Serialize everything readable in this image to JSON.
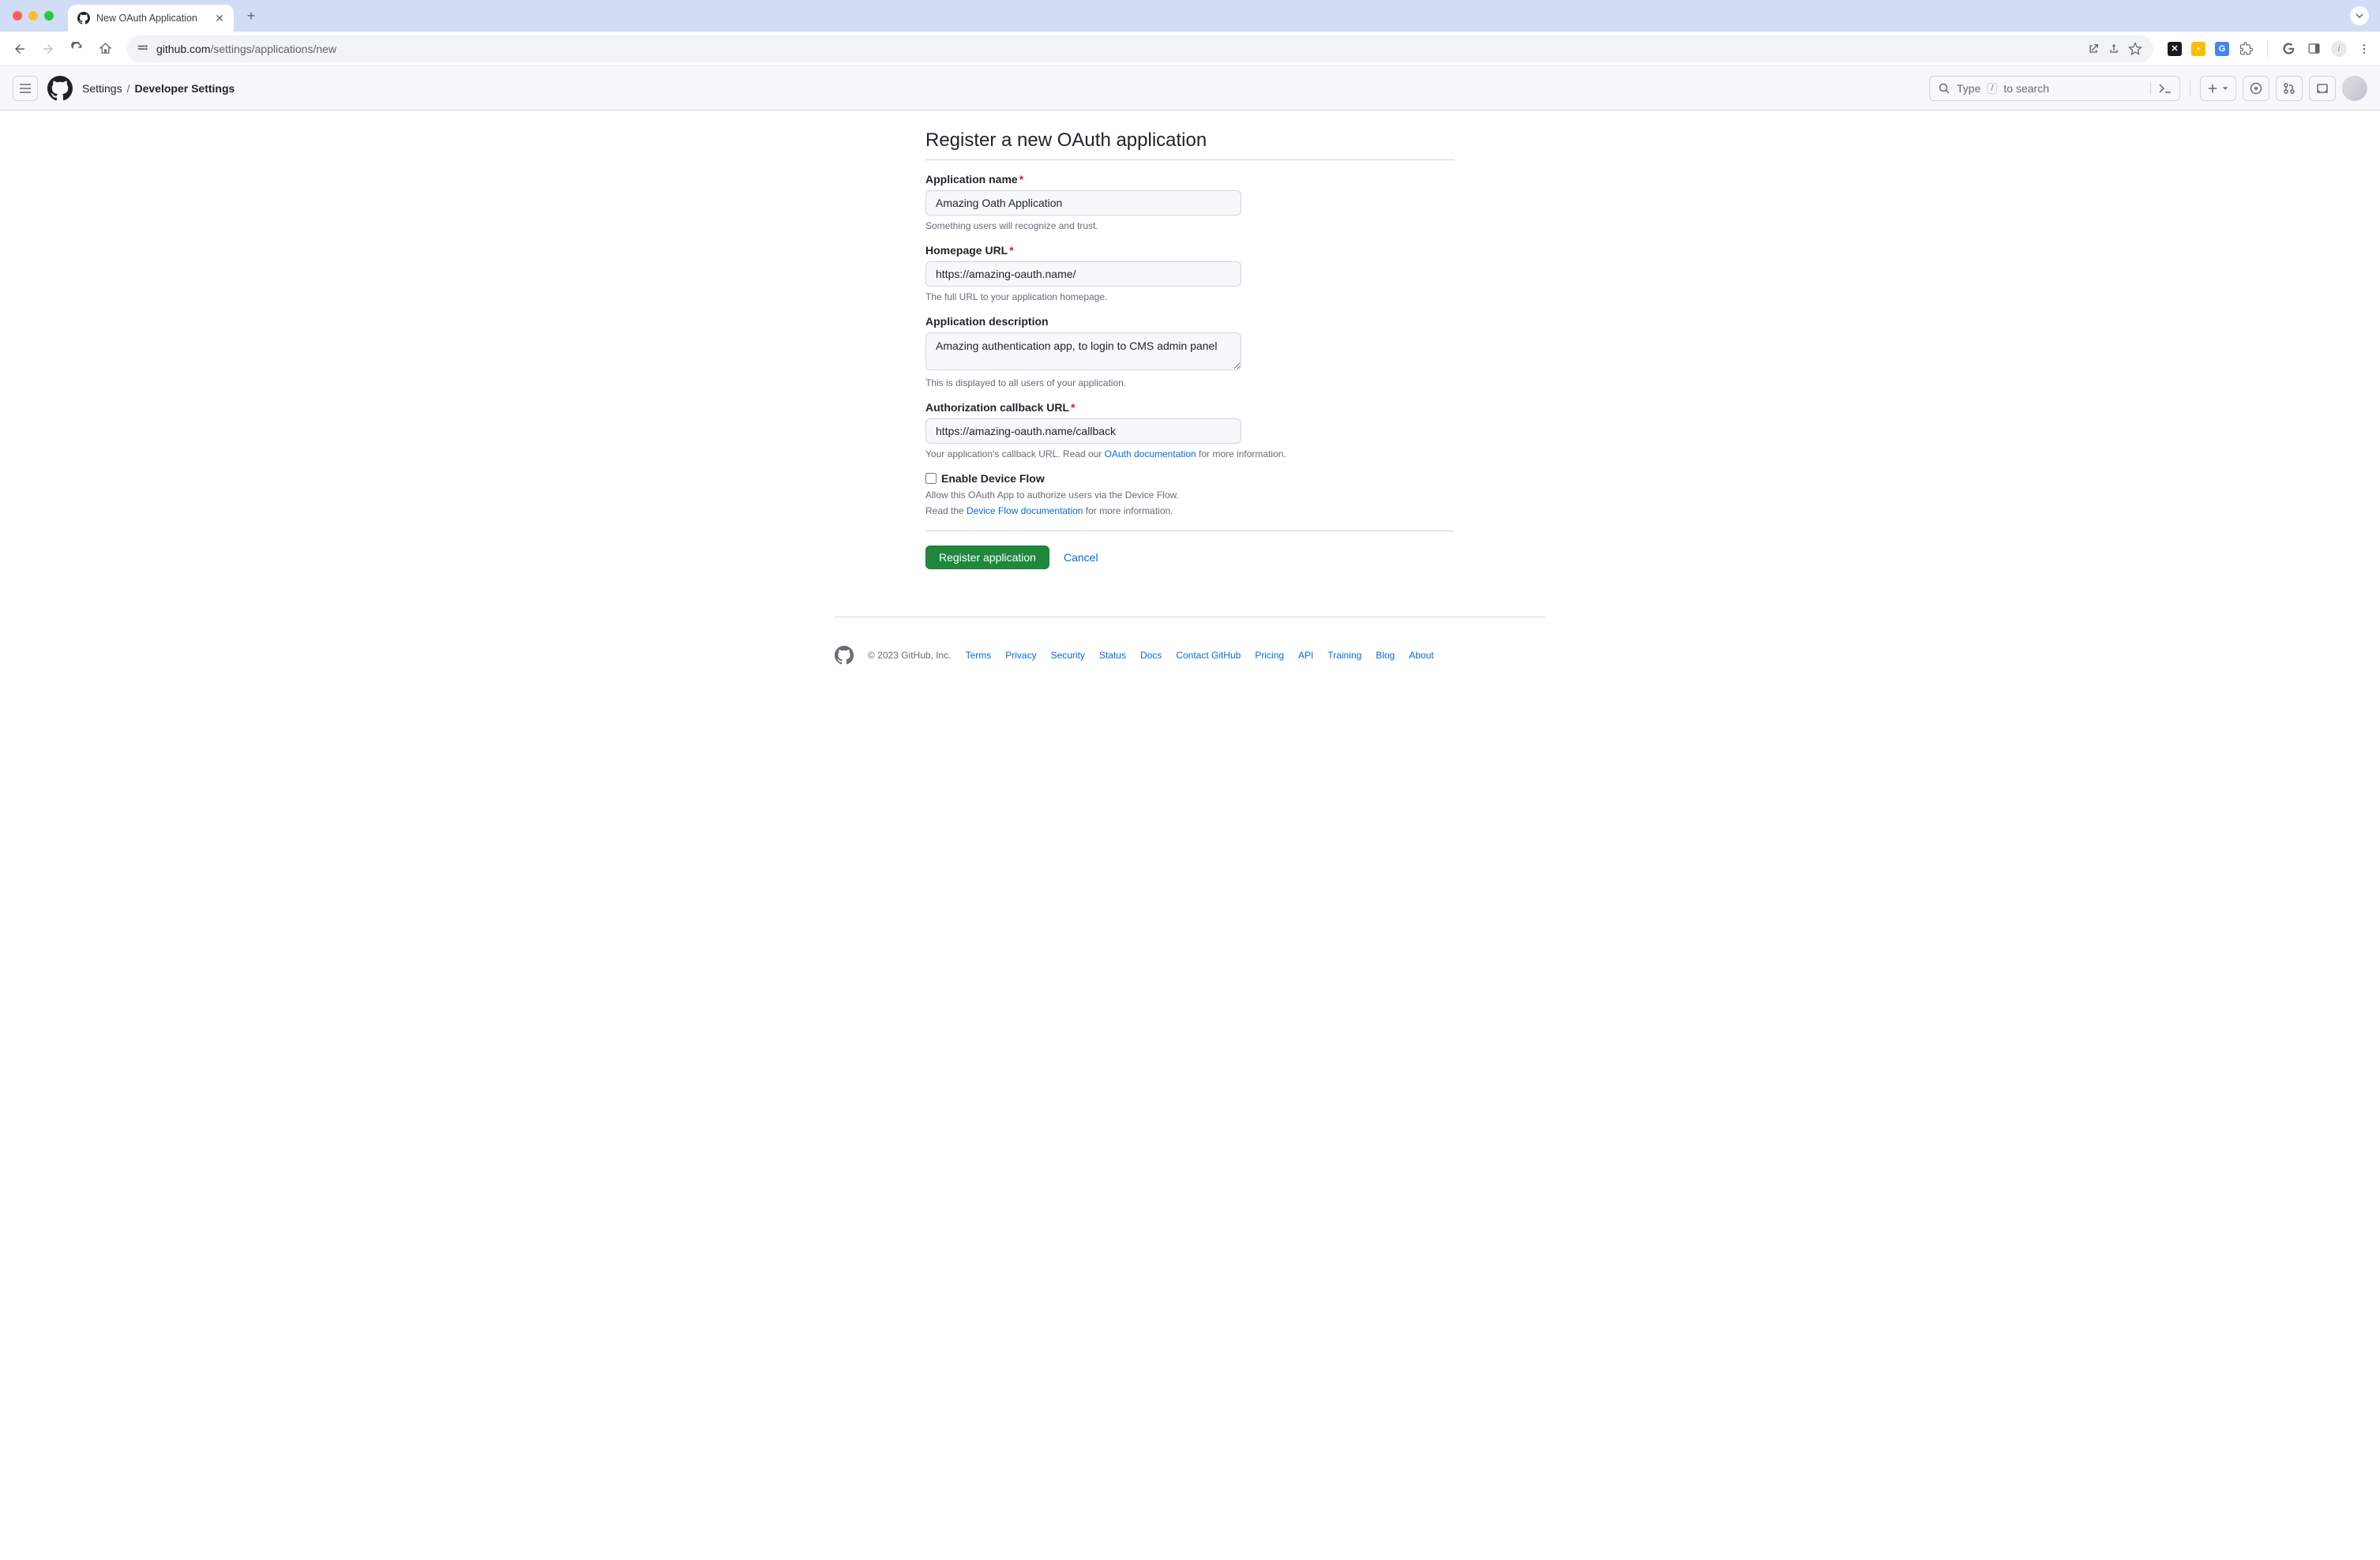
{
  "browser": {
    "tab_title": "New OAuth Application",
    "url_domain": "github.com",
    "url_path": "/settings/applications/new"
  },
  "header": {
    "breadcrumb_settings": "Settings",
    "breadcrumb_current": "Developer Settings",
    "search_placeholder_pre": "Type",
    "search_slash": "/",
    "search_placeholder_post": "to search"
  },
  "page": {
    "title": "Register a new OAuth application"
  },
  "form": {
    "app_name": {
      "label": "Application name",
      "value": "Amazing Oath Application",
      "help": "Something users will recognize and trust."
    },
    "homepage": {
      "label": "Homepage URL",
      "value": "https://amazing-oauth.name/",
      "help": "The full URL to your application homepage."
    },
    "description": {
      "label": "Application description",
      "value": "Amazing authentication app, to login to CMS admin panel",
      "help": "This is displayed to all users of your application."
    },
    "callback": {
      "label": "Authorization callback URL",
      "value": "https://amazing-oauth.name/callback",
      "help_pre": "Your application's callback URL. Read our ",
      "help_link": "OAuth documentation",
      "help_post": " for more information."
    },
    "device_flow": {
      "label": "Enable Device Flow",
      "help1": "Allow this OAuth App to authorize users via the Device Flow.",
      "help2_pre": "Read the ",
      "help2_link": "Device Flow documentation",
      "help2_post": " for more information."
    },
    "submit": "Register application",
    "cancel": "Cancel"
  },
  "footer": {
    "copyright": "© 2023 GitHub, Inc.",
    "links": [
      "Terms",
      "Privacy",
      "Security",
      "Status",
      "Docs",
      "Contact GitHub",
      "Pricing",
      "API",
      "Training",
      "Blog",
      "About"
    ]
  }
}
